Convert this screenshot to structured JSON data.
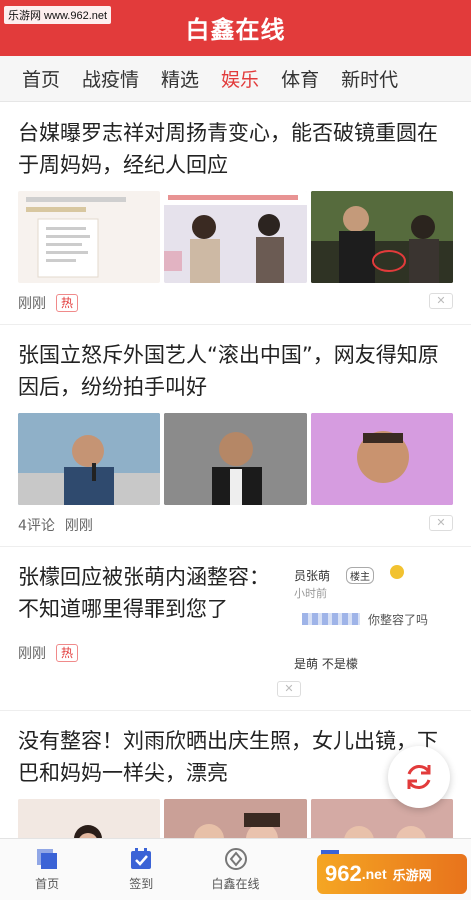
{
  "app": {
    "title": "白鑫在线",
    "watermark": "乐游网 www.962.net"
  },
  "tabs": [
    "首页",
    "战疫情",
    "精选",
    "娱乐",
    "体育",
    "新时代"
  ],
  "active_tab": "娱乐",
  "feed": [
    {
      "headline": "台媒曝罗志祥对周扬青变心，能否破镜重圆在于周妈妈，经纪人回应",
      "time": "刚刚",
      "hot": "热",
      "thumb_caption": "经纪人回应"
    },
    {
      "headline": "张国立怒斥外国艺人“滚出中国”，网友得知原因后，纷纷拍手叫好",
      "comments": "4评论",
      "time": "刚刚"
    },
    {
      "headline": "张檬回应被张萌内涵整容：不知道哪里得罪到您了",
      "time": "刚刚",
      "hot": "热",
      "img_text_1": "员张萌",
      "img_text_2": "楼主",
      "img_text_3": "小时前",
      "img_text_4": "你整容了吗",
      "img_text_5": "是萌 不是檬"
    },
    {
      "headline": "没有整容！刘雨欣晒出庆生照，女儿出镜，下巴和妈妈一样尖，漂亮"
    }
  ],
  "bottom_nav": [
    {
      "label": "首页",
      "icon": "home-icon"
    },
    {
      "label": "签到",
      "icon": "checkin-icon"
    },
    {
      "label": "白鑫在线",
      "icon": "compass-icon"
    },
    {
      "label": "帐",
      "icon": "account-icon"
    },
    {
      "label": "",
      "icon": "more-icon"
    }
  ],
  "watermark_bottom": {
    "brand": "962",
    "domain": ".net",
    "sub": "乐游网"
  },
  "colors": {
    "accent": "#e23b3b",
    "nav_blue": "#3b63d6"
  }
}
